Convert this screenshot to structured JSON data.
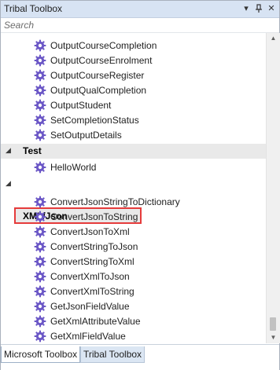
{
  "window": {
    "title": "Tribal Toolbox",
    "dropdown_icon": "dropdown-arrow-icon",
    "pin_icon": "pin-icon",
    "close_icon": "close-icon"
  },
  "search": {
    "placeholder": "Search"
  },
  "list": {
    "group_top_items": [
      "OutputCourseCompletion",
      "OutputCourseEnrolment",
      "OutputCourseRegister",
      "OutputQualCompletion",
      "OutputStudent",
      "SetCompletionStatus",
      "SetOutputDetails"
    ],
    "categories": [
      {
        "label": "Test",
        "items": [
          "HelloWorld"
        ]
      },
      {
        "label": "XML/Json",
        "items": [
          "ConvertJsonStringToDictionary",
          "ConvertJsonToString",
          "ConvertJsonToXml",
          "ConvertStringToJson",
          "ConvertStringToXml",
          "ConvertXmlToJson",
          "ConvertXmlToString",
          "GetJsonFieldValue",
          "GetXmlAttributeValue",
          "GetXmlFieldValue"
        ]
      }
    ],
    "item_icon": "gear-icon",
    "expanded_icon": "expanded-triangle-icon",
    "highlight_color": "#e53b3b"
  },
  "tabs": [
    "Microsoft Toolbox",
    "Tribal Toolbox"
  ],
  "active_tab": "Microsoft Toolbox"
}
